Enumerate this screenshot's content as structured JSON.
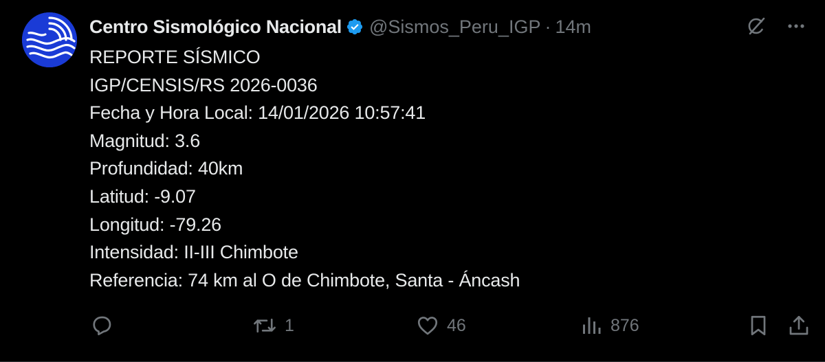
{
  "author": {
    "display_name": "Centro Sismológico Nacional",
    "handle": "@Sismos_Peru_IGP",
    "separator": "·",
    "time": "14m",
    "verified_color": "#1d9bf0"
  },
  "body_lines": [
    "REPORTE SÍSMICO",
    "IGP/CENSIS/RS 2026-0036",
    "Fecha y Hora Local: 14/01/2026 10:57:41",
    "Magnitud: 3.6",
    "Profundidad: 40km",
    "Latitud: -9.07",
    "Longitud: -79.26",
    "Intensidad: II-III Chimbote",
    "Referencia: 74 km al O de Chimbote, Santa - Áncash"
  ],
  "actions": {
    "reply_count": "",
    "repost_count": "1",
    "like_count": "46",
    "views_count": "876"
  },
  "icons": {
    "top_right": [
      "grok-icon",
      "more-icon"
    ],
    "actions": [
      "reply-icon",
      "repost-icon",
      "like-icon",
      "views-icon",
      "bookmark-icon",
      "share-icon"
    ]
  },
  "colors": {
    "background": "#000000",
    "text": "#e7e9ea",
    "muted": "#71767b",
    "avatar": "#1a3bd6"
  }
}
